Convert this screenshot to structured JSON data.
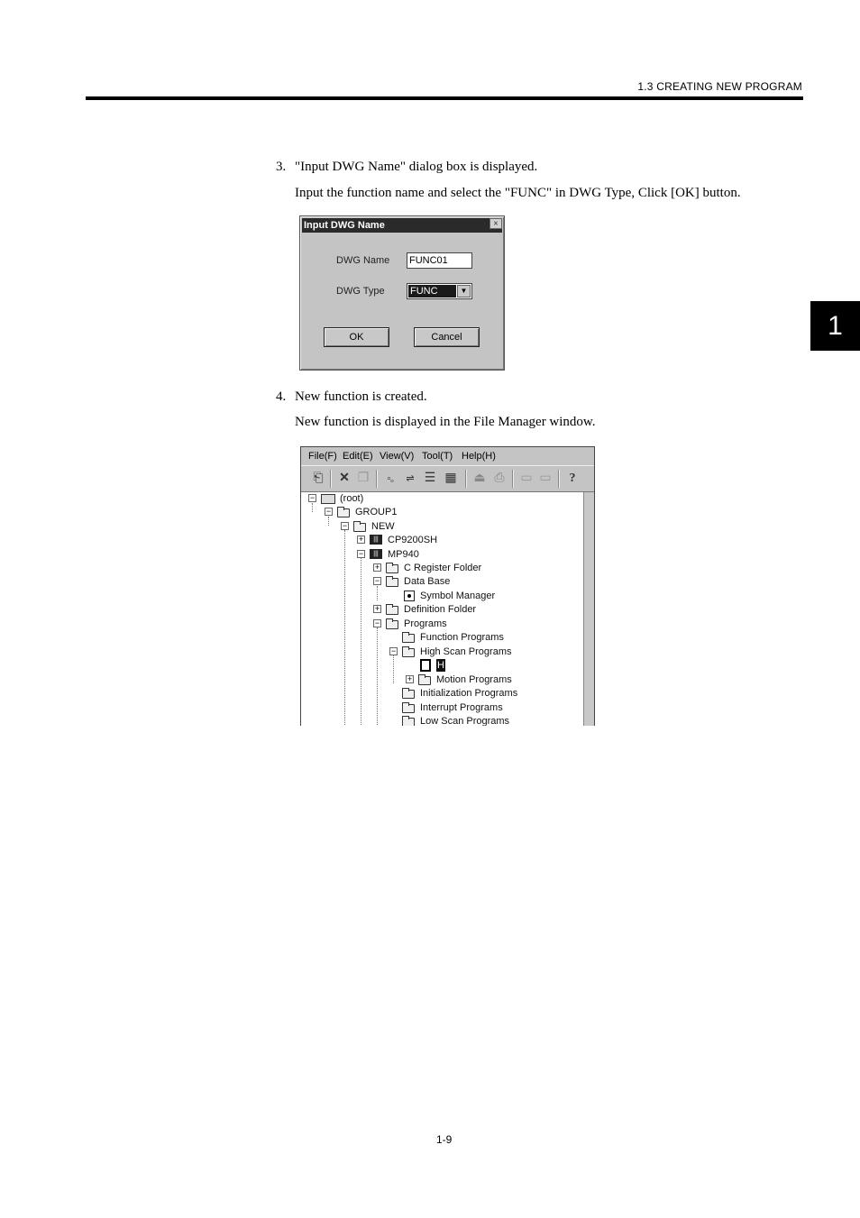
{
  "header": {
    "section": "1.3  CREATING NEW PROGRAM",
    "chapter_tab": "1"
  },
  "steps": [
    {
      "number": "3.",
      "title": "\"Input DWG Name\" dialog box is displayed.",
      "detail": "Input the function name and select the \"FUNC\" in DWG Type, Click [OK] button."
    },
    {
      "number": "4.",
      "title": "New function is created.",
      "detail": "New function is displayed in the File Manager window."
    }
  ],
  "dialog": {
    "title": "Input DWG Name",
    "close": "×",
    "name_label": "DWG Name",
    "name_value": "FUNC01",
    "type_label": "DWG Type",
    "type_value": "FUNC",
    "dropdown_arrow": "▼",
    "ok": "OK",
    "cancel": "Cancel"
  },
  "file_manager": {
    "menus": [
      "File(F)",
      "Edit(E)",
      "View(V)",
      "Tool(T)",
      "Help(H)"
    ],
    "toolbar_icons": [
      "up-folder-icon",
      "delete-icon",
      "properties-icon",
      "large-icons-icon",
      "small-icons-icon",
      "list-icon",
      "details-icon",
      "upload-icon",
      "download-icon",
      "connect-icon",
      "disconnect-icon",
      "help-icon"
    ],
    "tree": [
      {
        "label": "(root)",
        "expander": "−"
      },
      {
        "label": "GROUP1",
        "expander": "−"
      },
      {
        "label": "NEW",
        "expander": "−"
      },
      {
        "label": "CP9200SH",
        "expander": "+"
      },
      {
        "label": "MP940",
        "expander": "−"
      },
      {
        "label": "C Register Folder",
        "expander": "+"
      },
      {
        "label": "Data Base",
        "expander": "−"
      },
      {
        "label": "Symbol Manager",
        "expander": ""
      },
      {
        "label": "Definition Folder",
        "expander": "+"
      },
      {
        "label": "Programs",
        "expander": "−"
      },
      {
        "label": "Function Programs",
        "expander": ""
      },
      {
        "label": "High Scan Programs",
        "expander": "−"
      },
      {
        "label": "H",
        "expander": ""
      },
      {
        "label": "Motion Programs",
        "expander": "+"
      },
      {
        "label": "Initialization Programs",
        "expander": ""
      },
      {
        "label": "Interrupt Programs",
        "expander": ""
      },
      {
        "label": "Low Scan Programs",
        "expander": ""
      }
    ]
  },
  "page_number": "1-9"
}
